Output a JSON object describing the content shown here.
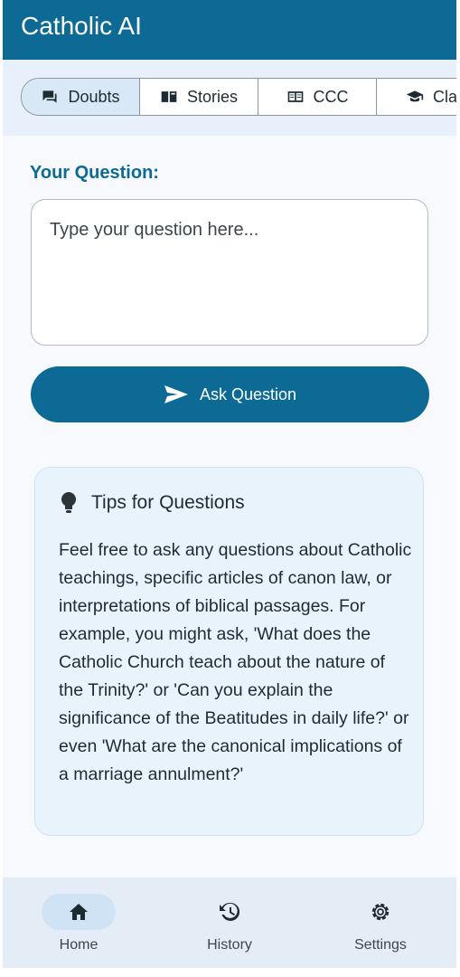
{
  "app": {
    "title": "Catholic AI"
  },
  "tabs": [
    {
      "label": "Doubts",
      "icon": "chat-icon"
    },
    {
      "label": "Stories",
      "icon": "book-icon"
    },
    {
      "label": "CCC",
      "icon": "open-book-icon"
    },
    {
      "label": "Clas",
      "icon": "graduation-cap-icon"
    }
  ],
  "question": {
    "label": "Your Question:",
    "placeholder": "Type your question here...",
    "ask_label": "Ask Question"
  },
  "tips": {
    "title": "Tips for Questions",
    "body": "Feel free to ask any questions about Catholic teachings, specific articles of canon law, or interpretations of biblical passages. For example, you might ask, 'What does the Catholic Church teach about the nature of the Trinity?' or 'Can you explain the significance of the Beatitudes in daily life?' or even 'What are the canonical implications of a marriage annulment?'"
  },
  "nav": {
    "home": "Home",
    "history": "History",
    "settings": "Settings"
  },
  "colors": {
    "primary": "#0c6a94",
    "tab_active": "#d8e8f6",
    "tips_bg": "#e9f3fc"
  }
}
